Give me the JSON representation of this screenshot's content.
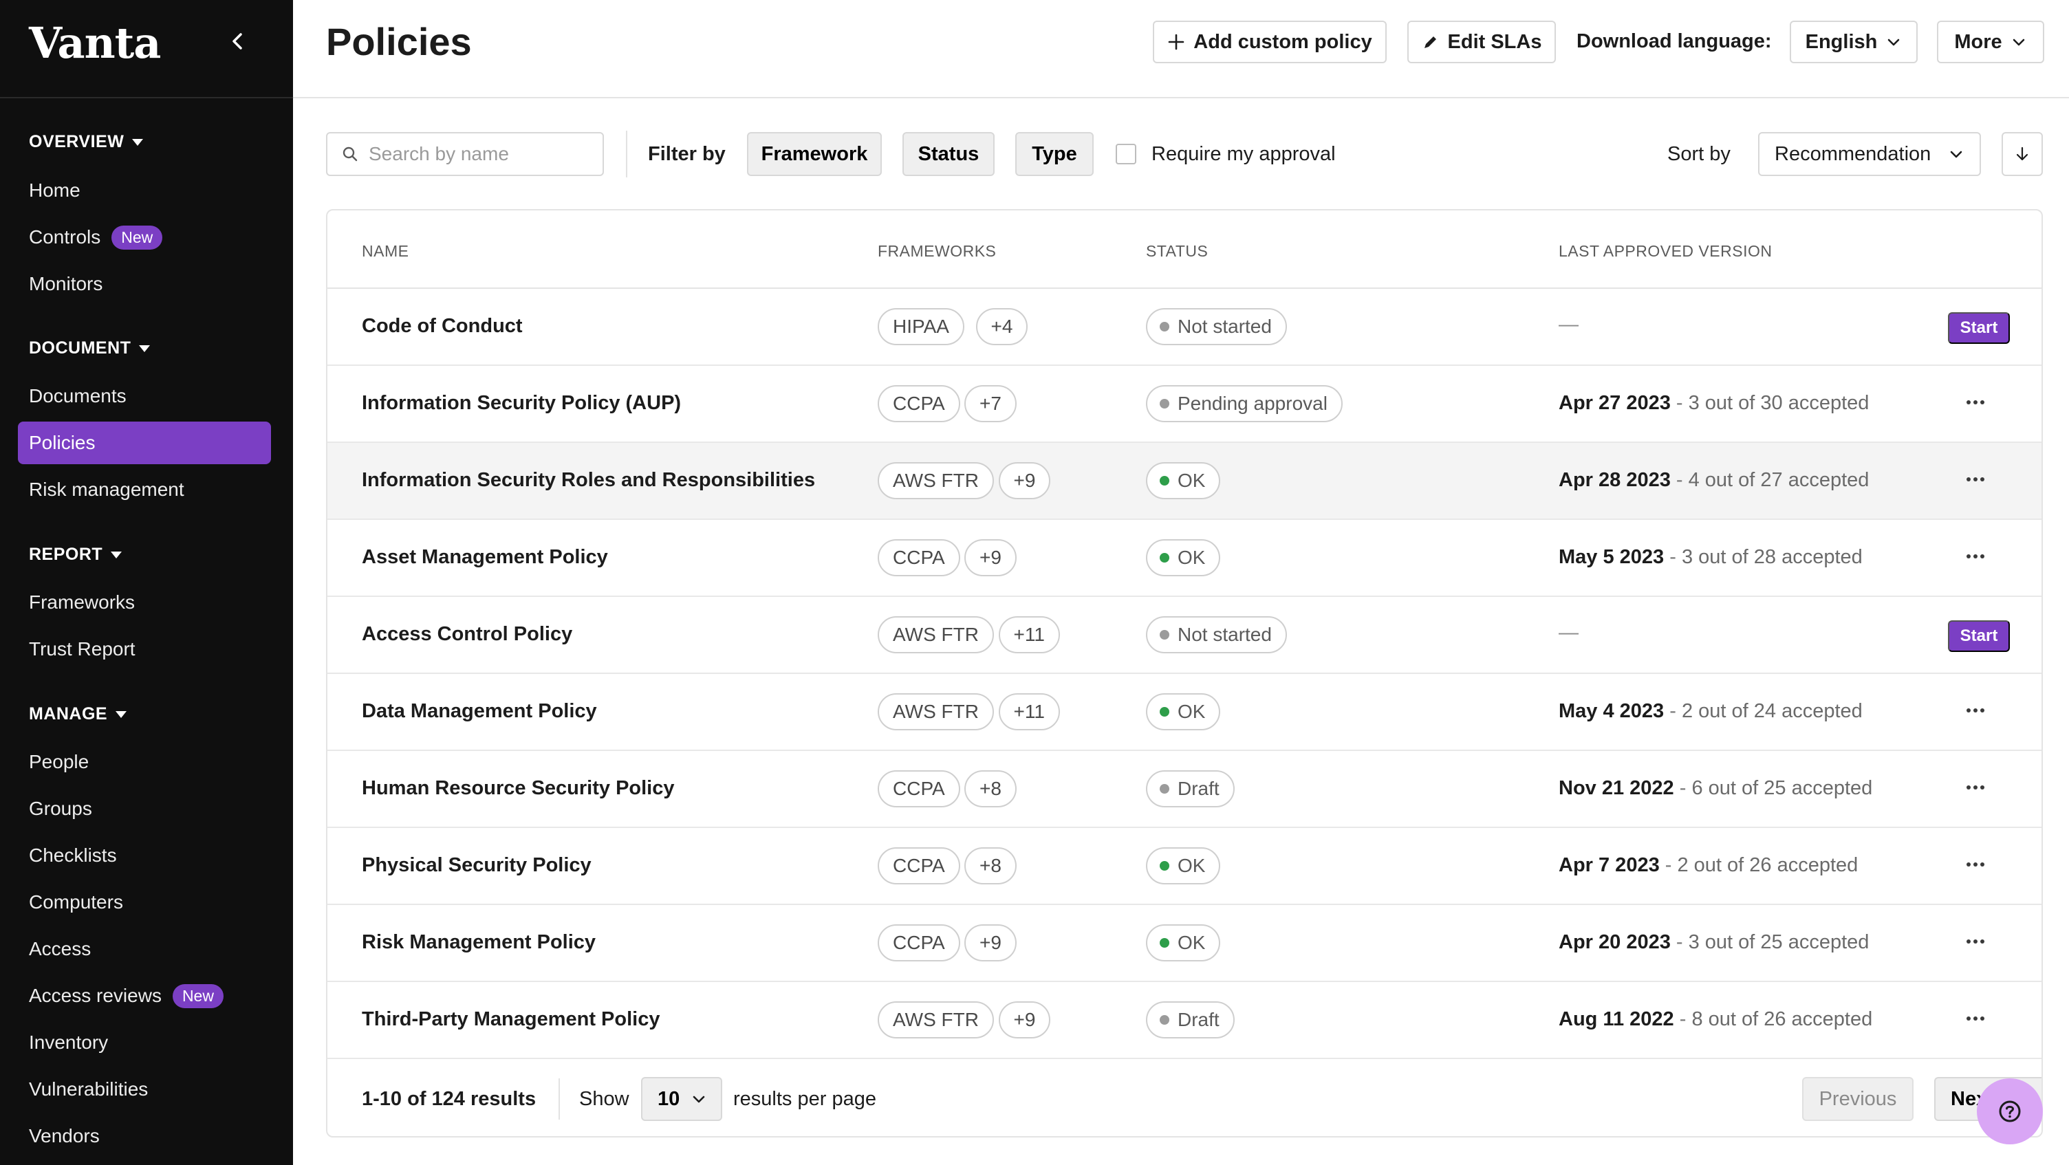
{
  "sidebar": {
    "logo": "Vanta",
    "sections": [
      {
        "title": "OVERVIEW",
        "items": [
          {
            "label": "Home"
          },
          {
            "label": "Controls",
            "badge": "New"
          },
          {
            "label": "Monitors"
          }
        ]
      },
      {
        "title": "DOCUMENT",
        "items": [
          {
            "label": "Documents"
          },
          {
            "label": "Policies",
            "active": true
          },
          {
            "label": "Risk management"
          }
        ]
      },
      {
        "title": "REPORT",
        "items": [
          {
            "label": "Frameworks"
          },
          {
            "label": "Trust Report"
          }
        ]
      },
      {
        "title": "MANAGE",
        "items": [
          {
            "label": "People"
          },
          {
            "label": "Groups"
          },
          {
            "label": "Checklists"
          },
          {
            "label": "Computers"
          },
          {
            "label": "Access"
          },
          {
            "label": "Access reviews",
            "badge": "New"
          },
          {
            "label": "Inventory"
          },
          {
            "label": "Vulnerabilities"
          },
          {
            "label": "Vendors"
          }
        ]
      }
    ]
  },
  "header": {
    "title": "Policies",
    "add_policy_label": "Add custom policy",
    "edit_slas_label": "Edit SLAs",
    "download_language_label": "Download language:",
    "language_value": "English",
    "more_label": "More"
  },
  "filters": {
    "search_placeholder": "Search by name",
    "filter_by_label": "Filter by",
    "framework_label": "Framework",
    "status_label": "Status",
    "type_label": "Type",
    "require_approval_label": "Require my approval",
    "sort_by_label": "Sort by",
    "sort_value": "Recommendation"
  },
  "table": {
    "columns": {
      "name": "NAME",
      "frameworks": "FRAMEWORKS",
      "status": "STATUS",
      "last_approved": "LAST APPROVED VERSION"
    },
    "start_label": "Start",
    "rows": [
      {
        "name": "Code of Conduct",
        "framework": "HIPAA",
        "more": "+4",
        "status": "Not started",
        "ok": false,
        "date": "",
        "accepted": "",
        "action": "start"
      },
      {
        "name": "Information Security Policy (AUP)",
        "framework": "CCPA",
        "more": "+7",
        "status": "Pending approval",
        "ok": false,
        "date": "Apr 27 2023",
        "accepted": "3 out of 30 accepted",
        "action": "menu"
      },
      {
        "name": "Information Security Roles and Responsibilities",
        "framework": "AWS FTR",
        "more": "+9",
        "status": "OK",
        "ok": true,
        "date": "Apr 28 2023",
        "accepted": "4 out of 27 accepted",
        "action": "menu",
        "hover": true
      },
      {
        "name": "Asset Management Policy",
        "framework": "CCPA",
        "more": "+9",
        "status": "OK",
        "ok": true,
        "date": "May 5 2023",
        "accepted": "3 out of 28 accepted",
        "action": "menu"
      },
      {
        "name": "Access Control Policy",
        "framework": "AWS FTR",
        "more": "+11",
        "status": "Not started",
        "ok": false,
        "date": "",
        "accepted": "",
        "action": "start"
      },
      {
        "name": "Data Management Policy",
        "framework": "AWS FTR",
        "more": "+11",
        "status": "OK",
        "ok": true,
        "date": "May 4 2023",
        "accepted": "2 out of 24 accepted",
        "action": "menu"
      },
      {
        "name": "Human Resource Security Policy",
        "framework": "CCPA",
        "more": "+8",
        "status": "Draft",
        "ok": false,
        "date": "Nov 21 2022",
        "accepted": "6 out of 25 accepted",
        "action": "menu"
      },
      {
        "name": "Physical Security Policy",
        "framework": "CCPA",
        "more": "+8",
        "status": "OK",
        "ok": true,
        "date": "Apr 7 2023",
        "accepted": "2 out of 26 accepted",
        "action": "menu"
      },
      {
        "name": "Risk Management Policy",
        "framework": "CCPA",
        "more": "+9",
        "status": "OK",
        "ok": true,
        "date": "Apr 20 2023",
        "accepted": "3 out of 25 accepted",
        "action": "menu"
      },
      {
        "name": "Third-Party Management Policy",
        "framework": "AWS FTR",
        "more": "+9",
        "status": "Draft",
        "ok": false,
        "date": "Aug 11 2022",
        "accepted": "8 out of 26 accepted",
        "action": "menu"
      }
    ]
  },
  "footer": {
    "results": "1-10 of 124 results",
    "show_label": "Show",
    "per_page_value": "10",
    "per_page_label": "results per page",
    "previous_label": "Previous",
    "next_label": "Next"
  },
  "colors": {
    "accent": "#7b3fc4",
    "sidebar_bg": "#0f0f0f",
    "ok_dot": "#2e9e4a",
    "help_fab": "#d9a6f5"
  },
  "icons": {
    "collapse": "chevron-left-icon",
    "add": "plus-icon",
    "edit": "pencil-icon",
    "dropdown": "chevron-down-icon",
    "search": "search-icon",
    "sort_direction": "arrow-down-icon",
    "row_menu": "more-horizontal-icon",
    "help": "help-circle-icon"
  }
}
